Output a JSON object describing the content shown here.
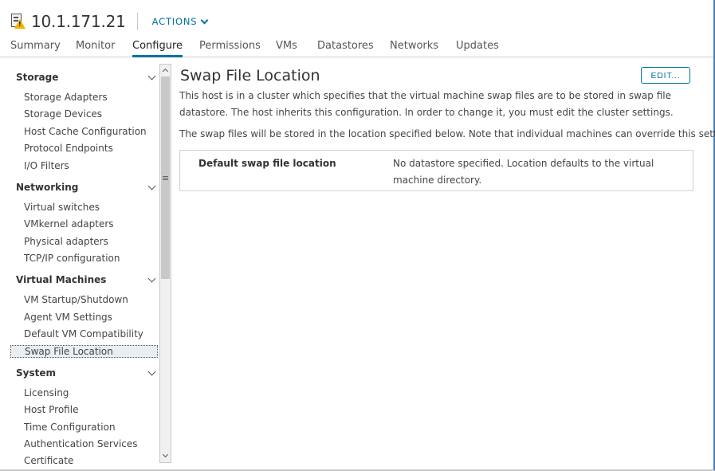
{
  "header": {
    "host_title": "10.1.171.21",
    "actions_label": "ACTIONS"
  },
  "tabs": [
    {
      "label": "Summary",
      "active": false
    },
    {
      "label": "Monitor",
      "active": false
    },
    {
      "label": "Configure",
      "active": true
    },
    {
      "label": "Permissions",
      "active": false
    },
    {
      "label": "VMs",
      "active": false
    },
    {
      "label": "Datastores",
      "active": false
    },
    {
      "label": "Networks",
      "active": false
    },
    {
      "label": "Updates",
      "active": false
    }
  ],
  "sidebar": {
    "sections": [
      {
        "title": "Storage",
        "items": [
          "Storage Adapters",
          "Storage Devices",
          "Host Cache Configuration",
          "Protocol Endpoints",
          "I/O Filters"
        ]
      },
      {
        "title": "Networking",
        "items": [
          "Virtual switches",
          "VMkernel adapters",
          "Physical adapters",
          "TCP/IP configuration"
        ]
      },
      {
        "title": "Virtual Machines",
        "items": [
          "VM Startup/Shutdown",
          "Agent VM Settings",
          "Default VM Compatibility",
          "Swap File Location"
        ]
      },
      {
        "title": "System",
        "items": [
          "Licensing",
          "Host Profile",
          "Time Configuration",
          "Authentication Services",
          "Certificate"
        ]
      }
    ],
    "selected_item": "Swap File Location"
  },
  "main": {
    "title": "Swap File Location",
    "edit_label": "EDIT...",
    "description": "This host is in a cluster which specifies that the virtual machine swap files are to be stored in swap file datastore. The host inherits this configuration. In order to change it, you must edit the cluster settings.",
    "note": "The swap files will be stored in the location specified below. Note that individual machines can override this setting.",
    "setting_label": "Default swap file location",
    "setting_value": "No datastore specified. Location defaults to the virtual machine directory."
  },
  "colors": {
    "accent": "#0072a3",
    "warning": "#f3b200"
  },
  "icons": {
    "host": "host-warning-icon",
    "expand": "chevron-down-icon"
  }
}
